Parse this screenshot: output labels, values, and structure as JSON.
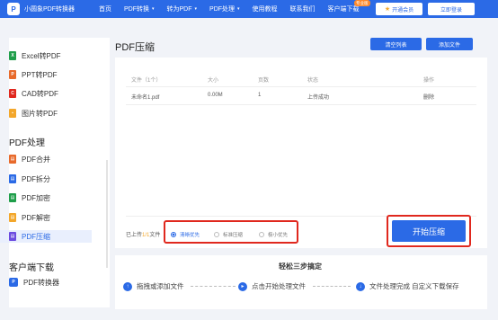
{
  "header": {
    "logo_text": "小圆象PDF转换器",
    "nav": [
      {
        "label": "首页"
      },
      {
        "label": "PDF转换",
        "caret": "▾"
      },
      {
        "label": "转为PDF",
        "caret": "▾"
      },
      {
        "label": "PDF处理",
        "caret": "▾"
      },
      {
        "label": "使用教程"
      },
      {
        "label": "联系我们"
      },
      {
        "label": "客户端下载",
        "badge": "专业版"
      }
    ],
    "vip_label": "开通会员",
    "login_label": "立即登录"
  },
  "sidebar": {
    "convert_items": [
      {
        "label": "Excel转PDF",
        "color": "#1f9e4a"
      },
      {
        "label": "PPT转PDF",
        "color": "#e86a2b"
      },
      {
        "label": "CAD转PDF",
        "color": "#e0281e"
      },
      {
        "label": "图片转PDF",
        "color": "#f3a72b"
      }
    ],
    "section_process": "PDF处理",
    "process_items": [
      {
        "label": "PDF合并",
        "color": "#e86a2b"
      },
      {
        "label": "PDF拆分",
        "color": "#2b6ae6"
      },
      {
        "label": "PDF加密",
        "color": "#1f9e4a"
      },
      {
        "label": "PDF解密",
        "color": "#f3a72b"
      },
      {
        "label": "PDF压缩",
        "color": "#6b4be0"
      }
    ],
    "section_download": "客户端下载",
    "download_item": "PDF转换器"
  },
  "main": {
    "title": "PDF压缩",
    "clear_label": "清空列表",
    "add_label": "添加文件",
    "table": {
      "headers": [
        "文件（1个）",
        "大小",
        "页数",
        "状态",
        "操作"
      ],
      "rows": [
        [
          "未命名1.pdf",
          "0.00M",
          "1",
          "上传成功",
          "删除"
        ]
      ]
    },
    "upload_note_prefix": "已上传",
    "upload_count": "1/1",
    "upload_note_suffix": "文件",
    "options": [
      {
        "label": "清晰优先",
        "selected": true
      },
      {
        "label": "标准压缩",
        "selected": false
      },
      {
        "label": "极小优先",
        "selected": false
      }
    ],
    "start_label": "开始压缩"
  },
  "steps": {
    "title": "轻松三步搞定",
    "items": [
      "拖拽或添加文件",
      "点击开始处理文件",
      "文件处理完成 自定义下载保存"
    ]
  }
}
